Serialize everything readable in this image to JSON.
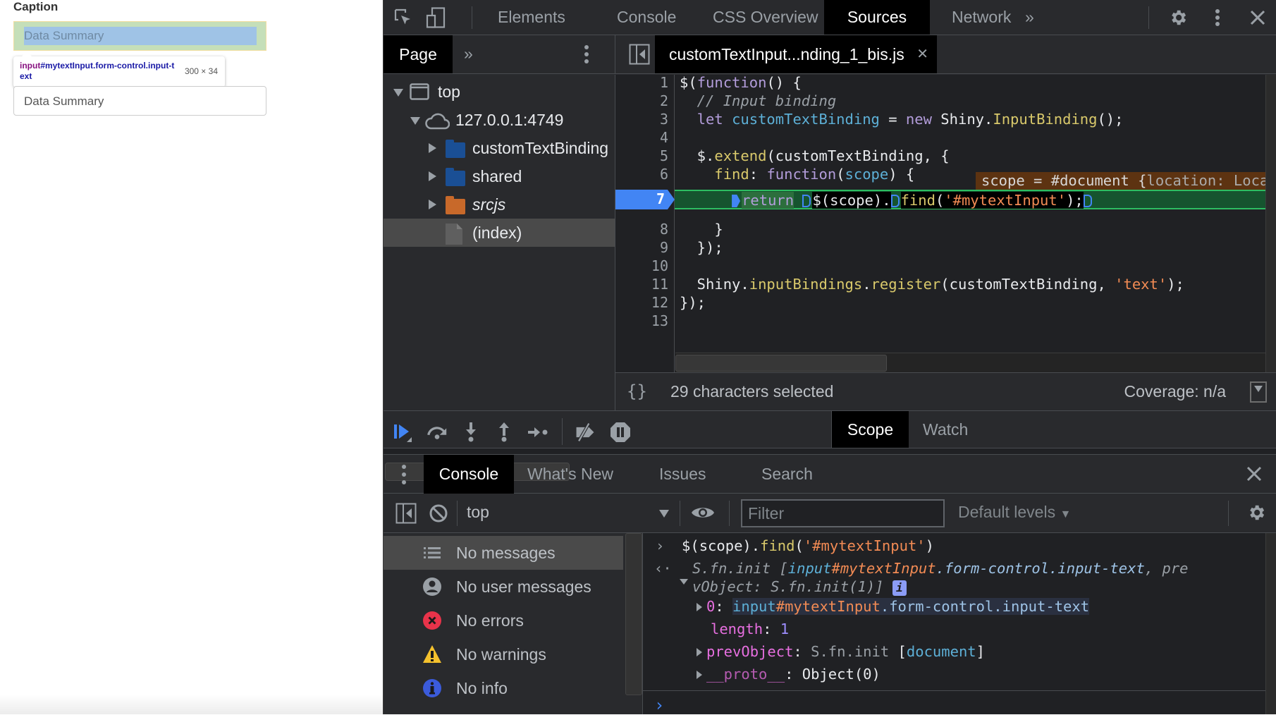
{
  "page": {
    "caption_label": "Caption",
    "highlighted_input_value": "Data Summary",
    "inspect_tooltip": {
      "tag": "input",
      "selector_rest": "#mytextInput.form-control.input-text",
      "size": "300 × 34"
    },
    "input_value": "Data Summary"
  },
  "devtools": {
    "main_tabs": [
      {
        "label": "Elements",
        "active": false
      },
      {
        "label": "Console",
        "active": false
      },
      {
        "label": "CSS Overview",
        "active": false
      },
      {
        "label": "Sources",
        "active": true
      },
      {
        "label": "Network",
        "active": false
      }
    ],
    "more_tabs_label": "»",
    "sources": {
      "navigator_tab": "Page",
      "navigator_more": "»",
      "file_tab": "customTextInput...nding_1_bis.js",
      "tree": [
        {
          "label": "top",
          "icon": "frame-icon",
          "level": 0,
          "expanded": true
        },
        {
          "label": "127.0.0.1:4749",
          "icon": "cloud-icon",
          "level": 1,
          "expanded": true
        },
        {
          "label": "customTextBinding",
          "icon": "folder-icon",
          "level": 2,
          "expanded": false,
          "color": "#1a5fb4"
        },
        {
          "label": "shared",
          "icon": "folder-icon",
          "level": 2,
          "expanded": false,
          "color": "#1a5fb4"
        },
        {
          "label": "srcjs",
          "icon": "folder-icon",
          "level": 2,
          "expanded": false,
          "color": "#d2691e",
          "italic": true
        },
        {
          "label": "(index)",
          "icon": "file-icon",
          "level": 2,
          "selected": true
        }
      ],
      "line_numbers": [
        "1",
        "2",
        "3",
        "4",
        "5",
        "6",
        "7",
        "8",
        "9",
        "10",
        "11",
        "12",
        "13"
      ],
      "current_line": "7",
      "code": {
        "l1_a": "$(",
        "l1_kw": "function",
        "l1_b": "() {",
        "l2": "  // Input binding",
        "l3_kw": "let",
        "l3_var": "customTextBinding",
        "l3_eq": " = ",
        "l3_new": "new",
        "l3_obj": " Shiny.",
        "l3_fn": "InputBinding",
        "l3_end": "();",
        "l5_a": "  $.",
        "l5_fn": "extend",
        "l5_b": "(customTextBinding, {",
        "l6_prop": "find",
        "l6_colon": ": ",
        "l6_kw": "function",
        "l6_p": "(",
        "l6_arg": "scope",
        "l6_end": ") {",
        "l7_kw": "return",
        "l7_a": "$(scope).",
        "l7_fn": "find",
        "l7_p": "(",
        "l7_str": "'#mytextInput'",
        "l7_end": ");",
        "l8": "    }",
        "l9": "  });",
        "l11_obj": "  Shiny.",
        "l11_prop": "inputBindings",
        "l11_dot": ".",
        "l11_fn": "register",
        "l11_a": "(customTextBinding, ",
        "l11_str": "'text'",
        "l11_end": ");",
        "l12": "});"
      },
      "inline_value": {
        "text": "scope = #document {",
        "prop": "location: Loca"
      },
      "status": {
        "selection": "29 characters selected",
        "coverage": "Coverage: n/a"
      }
    },
    "debugger": {
      "tabs": [
        {
          "label": "Scope",
          "active": true
        },
        {
          "label": "Watch",
          "active": false
        }
      ]
    },
    "drawer": {
      "tabs": [
        {
          "label": "Console",
          "active": true
        },
        {
          "label": "What's New",
          "active": false
        },
        {
          "label": "Issues",
          "active": false
        },
        {
          "label": "Search",
          "active": false
        }
      ]
    },
    "console": {
      "context": "top",
      "filter_placeholder": "Filter",
      "levels": "Default levels",
      "sidebar": [
        {
          "label": "No messages",
          "icon": "list-icon",
          "selected": true
        },
        {
          "label": "No user messages",
          "icon": "user-icon"
        },
        {
          "label": "No errors",
          "icon": "error-icon",
          "color": "#e8334a"
        },
        {
          "label": "No warnings",
          "icon": "warning-icon",
          "color": "#f4c12d"
        },
        {
          "label": "No info",
          "icon": "info-icon",
          "color": "#3b5bdb"
        }
      ],
      "input_expr": {
        "a": "$(scope).",
        "fn": "find",
        "p": "(",
        "str": "'#mytextInput'",
        "end": ")"
      },
      "result": {
        "head_a": "S.fn.init [",
        "head_tag": "input",
        "head_id": "#mytextInput",
        "head_cls": ".form-control.input-text",
        "head_b": ", pre",
        "head_c": "vObject: S.fn.init(1)]",
        "info": "i",
        "item0_key": "0",
        "item0_tag": "input",
        "item0_id": "#mytextInput",
        "item0_cls": ".form-control.input-text",
        "length_key": "length",
        "length_val": "1",
        "prev_key": "prevObject",
        "prev_val_a": "S.fn.init",
        "prev_val_b": "document",
        "proto_key": "__proto__",
        "proto_val": "Object(0)"
      },
      "prompt": "›"
    }
  }
}
